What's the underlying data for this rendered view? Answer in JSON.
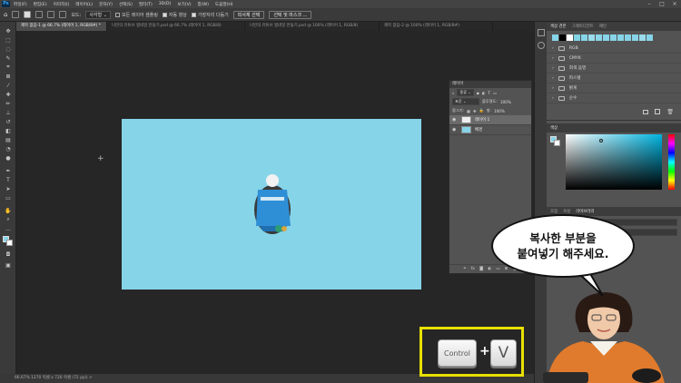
{
  "menu": {
    "logo": "Ps",
    "items": [
      "파일(F)",
      "편집(E)",
      "이미지(I)",
      "레이어(L)",
      "문자(Y)",
      "선택(S)",
      "필터(T)",
      "3D(D)",
      "보기(V)",
      "창(W)",
      "도움말(H)"
    ]
  },
  "options": {
    "mode_label": "모드:",
    "mode_value": "사각형",
    "sample_all": "모든 레이어 샘플링",
    "auto_enhance": "자동 향상",
    "edge_detect": "가장자리 다듬기",
    "select_subject": "피사체 선택",
    "select_mask": "선택 및 마스크 ..."
  },
  "tabs": [
    {
      "label": "제목 없음-1 @ 66.7% (레이어 1, RGB/8#) *",
      "active": true
    },
    {
      "label": "나만의 유튜브 썸네일 만들기.psd @ 66.7% (레이어 1, RGB/8)",
      "active": false
    },
    {
      "label": "나만의 유튜브 썸네일 만들기.psd @ 100% (레이어 1, RGB/8)",
      "active": false
    },
    {
      "label": "제목 없음-2 @ 100% (레이어 1, RGB/8#)",
      "active": false
    }
  ],
  "status": "66.67%   1270 픽셀 x 720 픽셀 (72 ppi)   >",
  "swatch_panel": {
    "tabs": [
      "색상 견본",
      "그레이디언트",
      "패턴"
    ],
    "folders": [
      "RGB",
      "CMYK",
      "회색 음영",
      "파스텔",
      "밝게",
      "순수"
    ]
  },
  "color_panel": {
    "tab": "색상"
  },
  "lower_panel": {
    "tabs": [
      "조정",
      "속성",
      "라이브러리"
    ]
  },
  "layers_panel": {
    "title": "레이어",
    "kind_label": "종류",
    "blend_mode": "표준",
    "opacity_label": "불투명도:",
    "opacity_value": "100%",
    "lock_label": "잠그기:",
    "fill_label": "칠:",
    "fill_value": "100%",
    "layers": [
      {
        "name": "레이어 1",
        "selected": true
      },
      {
        "name": "배경",
        "selected": false
      }
    ],
    "footer_fx": "fx"
  },
  "callout": {
    "line1": "복사한 부분을",
    "line2": "붙여넣기 해주세요."
  },
  "shortcut": {
    "key1": "Control",
    "plus": "+",
    "key2": "V"
  },
  "colors": {
    "canvas_bg": "#86d4e8",
    "highlight": "#e8e000",
    "shirt": "#e07a2c"
  }
}
